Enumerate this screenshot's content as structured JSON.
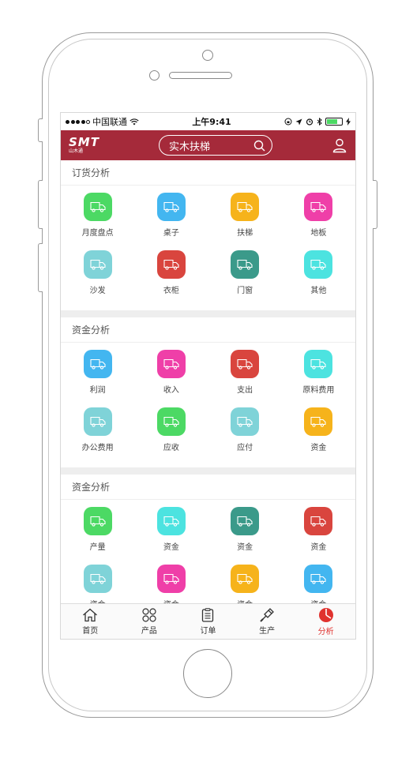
{
  "status_bar": {
    "carrier": "中国联通",
    "time": "上午9:41"
  },
  "header": {
    "logo": "SMT",
    "logo_sub": "山木通",
    "search_text": "实木扶梯"
  },
  "sections": [
    {
      "title": "订货分析",
      "items": [
        {
          "label": "月度盘点",
          "color": "#4cd964"
        },
        {
          "label": "桌子",
          "color": "#43b6f0"
        },
        {
          "label": "扶梯",
          "color": "#f6b31b"
        },
        {
          "label": "地板",
          "color": "#ef3fa8"
        },
        {
          "label": "沙发",
          "color": "#7fd3d8"
        },
        {
          "label": "衣柜",
          "color": "#d9453e"
        },
        {
          "label": "门窗",
          "color": "#3b9a8a"
        },
        {
          "label": "其他",
          "color": "#4ce3e0"
        }
      ]
    },
    {
      "title": "资金分析",
      "items": [
        {
          "label": "利润",
          "color": "#43b6f0"
        },
        {
          "label": "收入",
          "color": "#ef3fa8"
        },
        {
          "label": "支出",
          "color": "#d9453e"
        },
        {
          "label": "原料费用",
          "color": "#4ce3e0"
        },
        {
          "label": "办公费用",
          "color": "#7fd3d8"
        },
        {
          "label": "应收",
          "color": "#4cd964"
        },
        {
          "label": "应付",
          "color": "#7fd3d8"
        },
        {
          "label": "资金",
          "color": "#f6b31b"
        }
      ]
    },
    {
      "title": "资金分析",
      "items": [
        {
          "label": "产量",
          "color": "#4cd964"
        },
        {
          "label": "资金",
          "color": "#4ce3e0"
        },
        {
          "label": "资金",
          "color": "#3b9a8a"
        },
        {
          "label": "资金",
          "color": "#d9453e"
        },
        {
          "label": "资金",
          "color": "#7fd3d8"
        },
        {
          "label": "资金",
          "color": "#ef3fa8"
        },
        {
          "label": "资金",
          "color": "#f6b31b"
        },
        {
          "label": "资金",
          "color": "#43b6f0"
        }
      ]
    }
  ],
  "tabbar": {
    "tabs": [
      {
        "label": "首页",
        "icon": "home-icon"
      },
      {
        "label": "产品",
        "icon": "products-icon"
      },
      {
        "label": "订单",
        "icon": "orders-icon"
      },
      {
        "label": "生产",
        "icon": "production-icon"
      },
      {
        "label": "分析",
        "icon": "analysis-icon",
        "active": true
      }
    ]
  },
  "colors": {
    "brand": "#a52a3a",
    "active_tab": "#e0322e"
  }
}
